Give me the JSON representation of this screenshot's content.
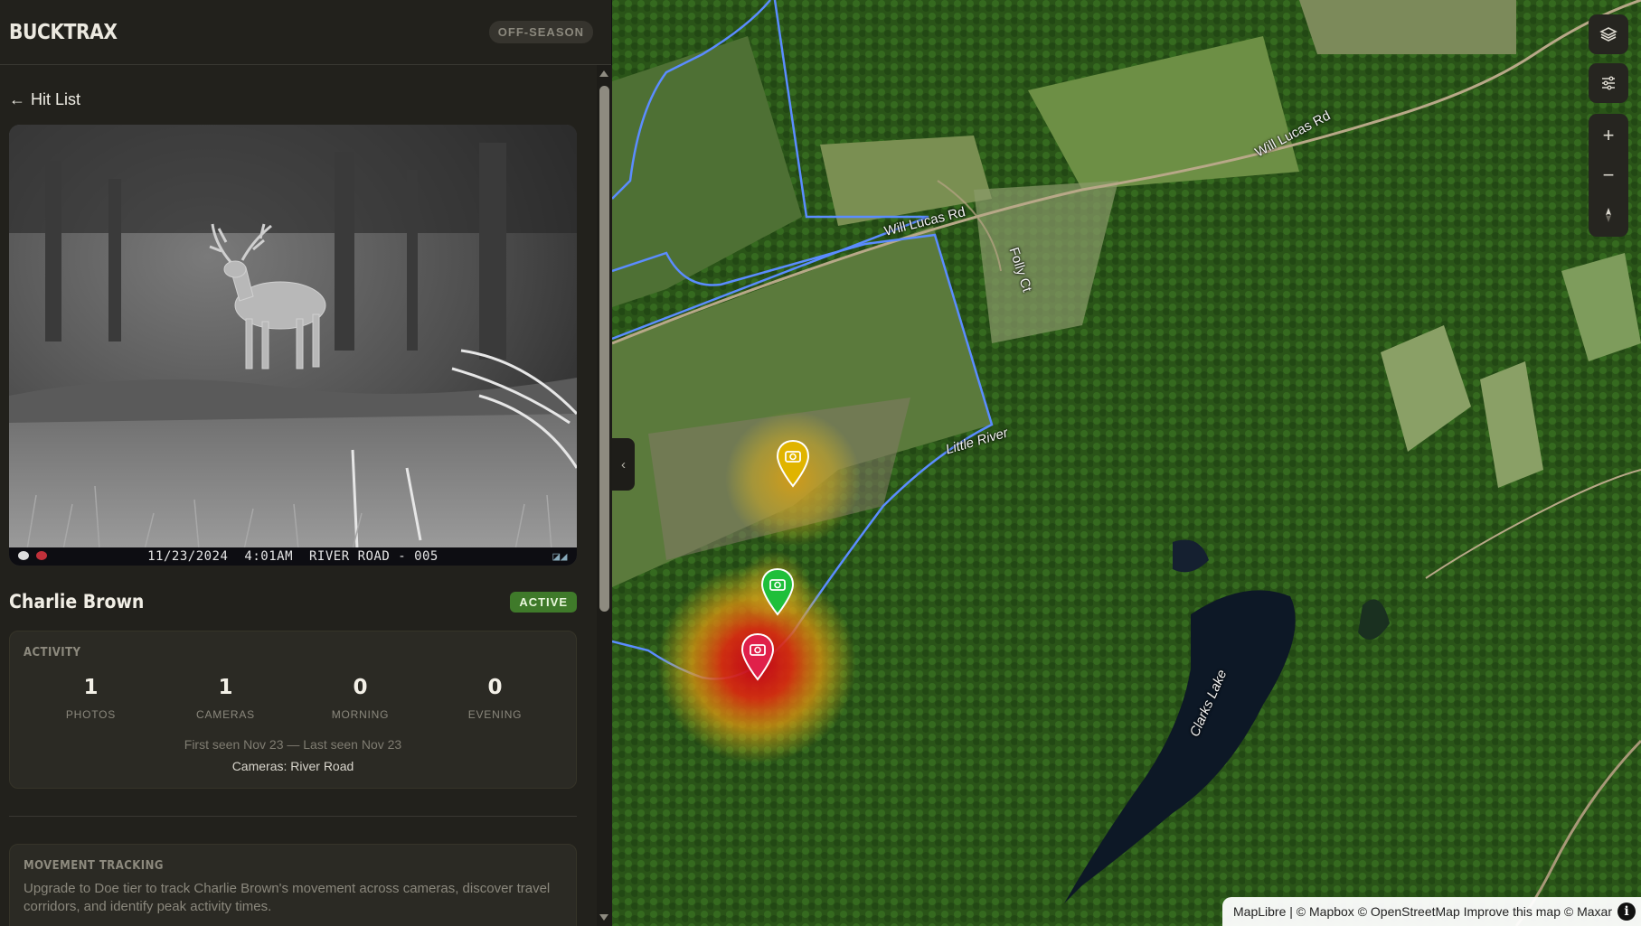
{
  "app": {
    "title": "BUCKTRAX",
    "season_badge": "OFF-SEASON"
  },
  "nav": {
    "back_arrow": "←",
    "back_label": "Hit List"
  },
  "photo": {
    "date": "11/23/2024",
    "time": "4:01AM",
    "camera_stamp": "RIVER ROAD - 005"
  },
  "deer": {
    "name": "Charlie Brown",
    "status": "ACTIVE"
  },
  "activity": {
    "title": "ACTIVITY",
    "stats": [
      {
        "value": "1",
        "label": "PHOTOS"
      },
      {
        "value": "1",
        "label": "CAMERAS"
      },
      {
        "value": "0",
        "label": "MORNING"
      },
      {
        "value": "0",
        "label": "EVENING"
      }
    ],
    "seen": "First seen Nov 23 — Last seen Nov 23",
    "cameras": "Cameras: River Road"
  },
  "movement": {
    "title": "MOVEMENT TRACKING",
    "text": "Upgrade to Doe tier to track Charlie Brown's movement across cameras, discover travel corridors, and identify peak activity times."
  },
  "map": {
    "labels": {
      "road_top_right": "Will Lucas Rd",
      "road_center": "Will Lucas Rd",
      "court": "Folly Ct",
      "river": "Little River",
      "lake": "Clarks Lake"
    },
    "collapse_icon": "chevron-left-icon",
    "controls": {
      "layers_icon": "layers-icon",
      "filters_icon": "sliders-icon",
      "zoom_in": "+",
      "zoom_out": "−",
      "compass_icon": "compass-icon"
    },
    "pins": [
      {
        "color": "#e0b400",
        "icon": "camera-icon"
      },
      {
        "color": "#1fbf3a",
        "icon": "camera-icon"
      },
      {
        "color": "#e0204a",
        "icon": "camera-icon"
      }
    ],
    "attribution": "MapLibre | © Mapbox © OpenStreetMap Improve this map © Maxar",
    "info_label": "i"
  },
  "colors": {
    "accent_green": "#3f7a2a",
    "boundary_blue": "#5b8cff",
    "heat_red": "#d8101a",
    "heat_yellow": "#e8c020"
  }
}
